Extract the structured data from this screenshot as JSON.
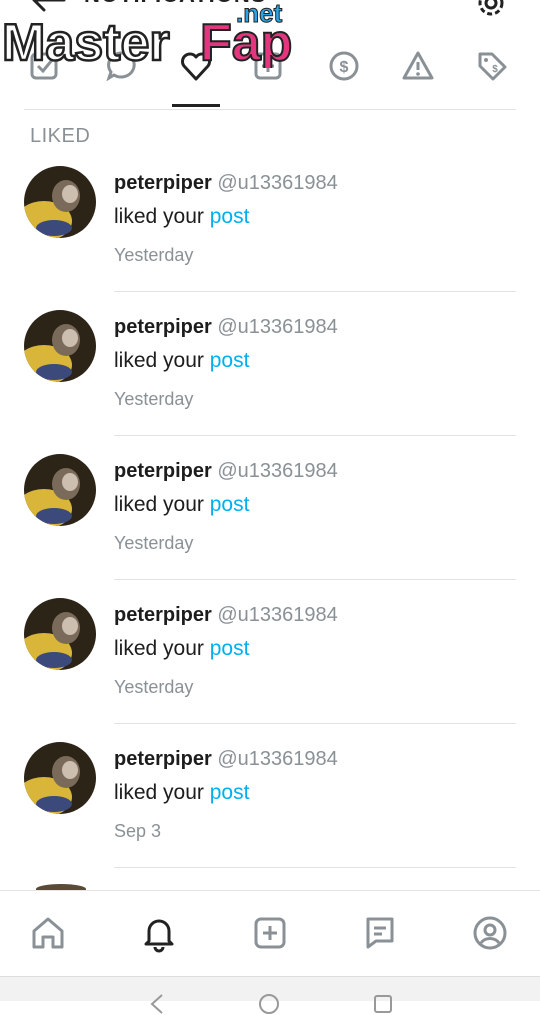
{
  "header": {
    "title": "NOTIFICATIONS",
    "watermark_brand_left": "Master",
    "watermark_brand_right": "Fap",
    "watermark_tld": ".net"
  },
  "tabs": [
    {
      "name": "tab-tagged",
      "icon": "checkbox-icon",
      "active": false
    },
    {
      "name": "tab-comments",
      "icon": "comment-icon",
      "active": false
    },
    {
      "name": "tab-liked",
      "icon": "heart-icon",
      "active": true
    },
    {
      "name": "tab-subscribed",
      "icon": "add-square-icon",
      "active": false
    },
    {
      "name": "tab-tipped",
      "icon": "dollar-icon",
      "active": false
    },
    {
      "name": "tab-alerts",
      "icon": "warning-icon",
      "active": false
    },
    {
      "name": "tab-promotions",
      "icon": "tag-icon",
      "active": false
    }
  ],
  "section": {
    "label": "LIKED"
  },
  "notifications": [
    {
      "name": "peterpiper",
      "handle": "@u13361984",
      "action": "liked your ",
      "link": "post",
      "time": "Yesterday"
    },
    {
      "name": "peterpiper",
      "handle": "@u13361984",
      "action": "liked your ",
      "link": "post",
      "time": "Yesterday"
    },
    {
      "name": "peterpiper",
      "handle": "@u13361984",
      "action": "liked your ",
      "link": "post",
      "time": "Yesterday"
    },
    {
      "name": "peterpiper",
      "handle": "@u13361984",
      "action": "liked your ",
      "link": "post",
      "time": "Yesterday"
    },
    {
      "name": "peterpiper",
      "handle": "@u13361984",
      "action": "liked your ",
      "link": "post",
      "time": "Sep 3"
    }
  ],
  "bottom_nav": [
    {
      "name": "nav-home",
      "icon": "home-icon",
      "active": false
    },
    {
      "name": "nav-notifications",
      "icon": "bell-icon",
      "active": true
    },
    {
      "name": "nav-new-post",
      "icon": "add-square-icon",
      "active": false
    },
    {
      "name": "nav-messages",
      "icon": "message-icon",
      "active": false
    },
    {
      "name": "nav-profile",
      "icon": "profile-icon",
      "active": false
    }
  ],
  "colors": {
    "accent": "#00aff0",
    "muted": "#8a9196",
    "text": "#1d1d1d",
    "watermark_pink": "#e3367f",
    "watermark_blue": "#2aa6e8"
  }
}
